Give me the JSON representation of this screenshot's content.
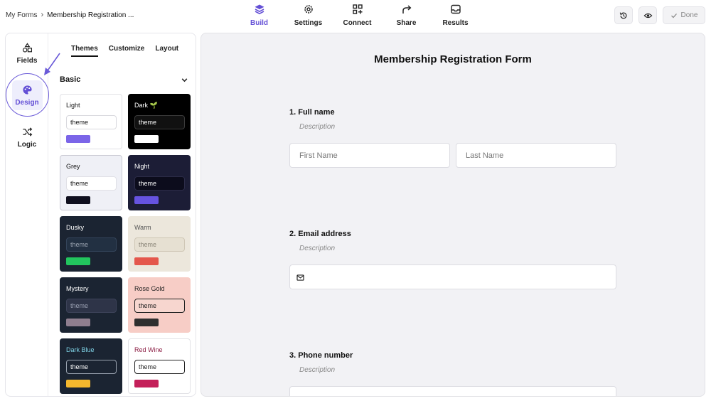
{
  "breadcrumb": {
    "root": "My Forms",
    "separator": "›",
    "current": "Membership Registration ..."
  },
  "nav_tabs": [
    {
      "label": "Build",
      "icon": "layers-icon",
      "active": true
    },
    {
      "label": "Settings",
      "icon": "gear-icon",
      "active": false
    },
    {
      "label": "Connect",
      "icon": "connect-grid-icon",
      "active": false
    },
    {
      "label": "Share",
      "icon": "share-arrow-icon",
      "active": false
    },
    {
      "label": "Results",
      "icon": "inbox-icon",
      "active": false
    }
  ],
  "toolbar": {
    "done_label": "Done"
  },
  "rail": [
    {
      "label": "Fields",
      "icon": "shapes-icon"
    },
    {
      "label": "Design",
      "icon": "palette-icon",
      "active": true
    },
    {
      "label": "Logic",
      "icon": "shuffle-icon"
    }
  ],
  "subtabs": [
    "Themes",
    "Customize",
    "Layout"
  ],
  "themes_section": {
    "title": "Basic"
  },
  "themes": [
    {
      "name": "Light",
      "pill": "theme",
      "card_bg": "#ffffff",
      "name_color": "#111111",
      "pill_bg": "#ffffff",
      "pill_border": "#d9d9de",
      "pill_color": "#111111",
      "swatch": "#7b65e8",
      "border": "#e2e2e6"
    },
    {
      "name": "Dark 🌱",
      "pill": "theme",
      "card_bg": "#000000",
      "name_color": "#ffffff",
      "pill_bg": "#111111",
      "pill_border": "#3a3a3a",
      "pill_color": "#ffffff",
      "swatch": "#ffffff",
      "border": "#000000"
    },
    {
      "name": "Grey",
      "pill": "theme",
      "card_bg": "#eff0f6",
      "name_color": "#111111",
      "pill_bg": "#ffffff",
      "pill_border": "#e0e0e6",
      "pill_color": "#111111",
      "swatch": "#0f0f1e",
      "border": "#c9c9d3"
    },
    {
      "name": "Night",
      "pill": "theme",
      "card_bg": "#1c1d36",
      "name_color": "#ffffff",
      "pill_bg": "#0c0c1c",
      "pill_border": "#2c2c48",
      "pill_color": "#ffffff",
      "swatch": "#6653e0",
      "border": "#1c1d36"
    },
    {
      "name": "Dusky",
      "pill": "theme",
      "card_bg": "#1b2432",
      "name_color": "#ffffff",
      "pill_bg": "#223042",
      "pill_border": "#34445a",
      "pill_color": "#9aa3b0",
      "swatch": "#22c55e",
      "border": "#1b2432"
    },
    {
      "name": "Warm",
      "pill": "theme",
      "card_bg": "#ece7dc",
      "name_color": "#555555",
      "pill_bg": "#e6e0d2",
      "pill_border": "#cfc7b6",
      "pill_color": "#8a8578",
      "swatch": "#e4574c",
      "border": "#ece7dc"
    },
    {
      "name": "Mystery",
      "pill": "theme",
      "card_bg": "#1b2432",
      "name_color": "#ffffff",
      "pill_bg": "#2e3448",
      "pill_border": "#3c4258",
      "pill_color": "#9aa0b2",
      "swatch": "#8f7e8f",
      "border": "#1b2432"
    },
    {
      "name": "Rose Gold",
      "pill": "theme",
      "card_bg": "#f7cdc6",
      "name_color": "#222222",
      "pill_bg": "#f7d6cf",
      "pill_border": "#222222",
      "pill_color": "#222222",
      "swatch": "#2f2f2f",
      "border": "#f7cdc6"
    },
    {
      "name": "Dark Blue",
      "pill": "theme",
      "card_bg": "#1b2432",
      "name_color": "#7fd3e6",
      "pill_bg": "#1b2432",
      "pill_border": "#9aa3b0",
      "pill_color": "#ffffff",
      "swatch": "#f5b82e",
      "border": "#1b2432"
    },
    {
      "name": "Red Wine",
      "pill": "theme",
      "card_bg": "#ffffff",
      "name_color": "#8c1f45",
      "pill_bg": "#ffffff",
      "pill_border": "#222222",
      "pill_color": "#222222",
      "swatch": "#c4205a",
      "border": "#e2e2e6"
    }
  ],
  "form": {
    "title": "Membership Registration Form",
    "questions": [
      {
        "label": "1.  Full name",
        "description": "Description",
        "fields": [
          "First Name",
          "Last Name"
        ]
      },
      {
        "label": "2.  Email address",
        "description": "Description",
        "fields": [
          ""
        ]
      },
      {
        "label": "3.  Phone number",
        "description": "Description",
        "fields": [
          ""
        ]
      }
    ]
  },
  "accent_color": "#6450d6"
}
